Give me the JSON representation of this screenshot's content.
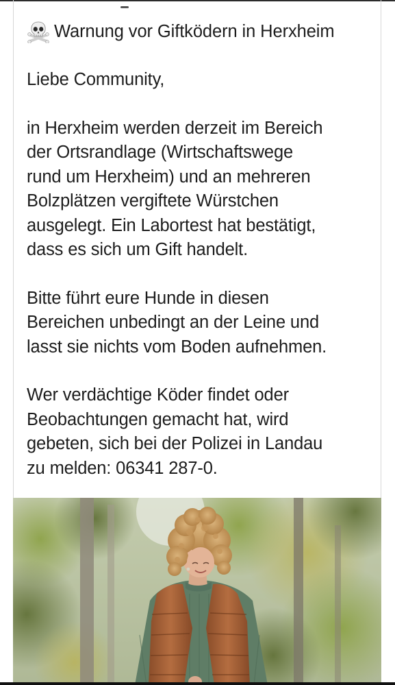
{
  "post": {
    "title": "Warnung vor Giftködern in Herxheim",
    "title_icon": "skull-and-crossbones-icon",
    "greeting": "Liebe Community,",
    "paragraph_1": "in Herxheim werden derzeit im Bereich\nder Ortsrandlage (Wirtschaftswege\nrund um Herxheim) und an mehreren\nBolzplätzen vergiftete Würstchen\nausgelegt. Ein Labortest hat bestätigt,\ndass es sich um Gift handelt.",
    "paragraph_2": "Bitte führt eure Hunde in diesen\nBereichen unbedingt an der Leine und\nlasst sie nichts vom Boden aufnehmen.",
    "paragraph_3": "Wer verdächtige Köder findet oder\nBeobachtungen gemacht hat, wird\ngebeten, sich bei der Polizei in Landau\nzu melden: 06341 287-0."
  },
  "photo": {
    "subject": "woman-with-curly-hair-in-park"
  },
  "colors": {
    "text": "#1c1c1c",
    "background": "#ffffff",
    "vest": "#a5623a",
    "sweater": "#5b7a62",
    "foliage": "#7d8f3e"
  }
}
